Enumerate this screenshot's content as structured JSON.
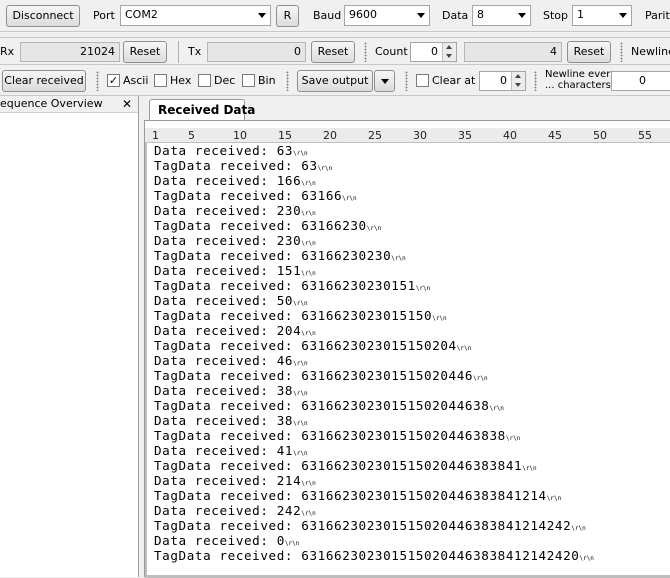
{
  "toolbar1": {
    "disconnect_label": "Disconnect",
    "port_label": "Port",
    "port_value": "COM2",
    "r_label": "R",
    "baud_label": "Baud",
    "baud_value": "9600",
    "data_label": "Data",
    "data_value": "8",
    "stop_label": "Stop",
    "stop_value": "1",
    "parity_label": "Parity"
  },
  "toolbar2": {
    "rx_label": "Rx",
    "rx_value": "21024",
    "rx_reset_label": "Reset",
    "tx_label": "Tx",
    "tx_value": "0",
    "tx_reset_label": "Reset",
    "count_label": "Count",
    "count_value": "0",
    "count_field_value": "4",
    "count_reset_label": "Reset",
    "newline_label": "Newline"
  },
  "toolbar3": {
    "clear_received_label": "Clear received",
    "ascii_label": "Ascii",
    "ascii_checked": true,
    "hex_label": "Hex",
    "dec_label": "Dec",
    "bin_label": "Bin",
    "save_output_label": "Save output",
    "clear_at_label": "Clear at",
    "clear_at_value": "0",
    "newline_every_label_1": "Newline every",
    "newline_every_label_2": "... characters",
    "newline_every_value": "0"
  },
  "sidebar": {
    "title": "equence Overview",
    "close_label": "✕"
  },
  "tab": {
    "label": "Received Data"
  },
  "ruler": [
    "1",
    "5",
    "10",
    "15",
    "20",
    "25",
    "30",
    "35",
    "40",
    "45",
    "50",
    "55"
  ],
  "received_lines": [
    "Data received: 63",
    "TagData received: 63",
    "Data received: 166",
    "TagData received: 63166",
    "Data received: 230",
    "TagData received: 63166230",
    "Data received: 230",
    "TagData received: 63166230230",
    "Data received: 151",
    "TagData received: 63166230230151",
    "Data received: 50",
    "TagData received: 6316623023015150",
    "Data received: 204",
    "TagData received: 6316623023015150204",
    "Data received: 46",
    "TagData received: 631662302301515020446",
    "Data received: 38",
    "TagData received: 63166230230151502044638",
    "Data received: 38",
    "TagData received: 6316623023015150204463838",
    "Data received: 41",
    "TagData received: 631662302301515020446383841",
    "Data received: 214",
    "TagData received: 631662302301515020446383841214",
    "Data received: 242",
    "TagData received: 631662302301515020446383841214242",
    "Data received: 0",
    "TagData received: 6316623023015150204463838412142420"
  ],
  "line_ending_marker": "\\r\\n"
}
